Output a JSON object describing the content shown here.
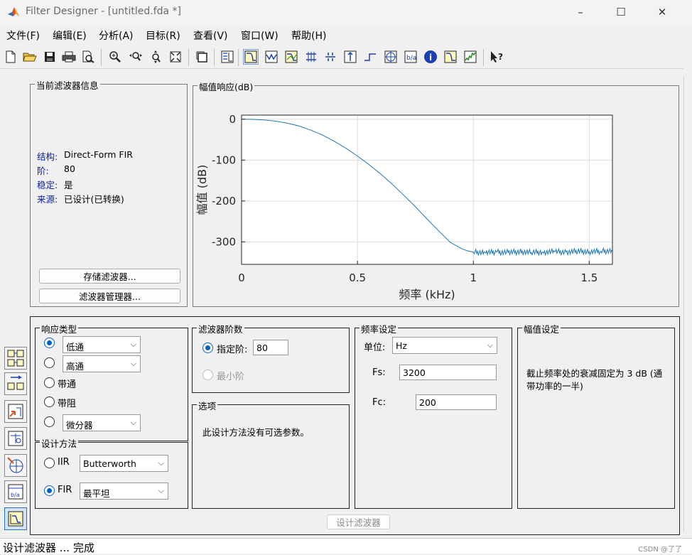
{
  "window": {
    "title": "Filter Designer  -  [untitled.fda *]",
    "minimize": "–",
    "maximize": "☐",
    "close": "✕"
  },
  "menu": [
    "文件(F)",
    "编辑(E)",
    "分析(A)",
    "目标(R)",
    "查看(V)",
    "窗口(W)",
    "帮助(H)"
  ],
  "toolbar_icons": [
    "new-file-icon",
    "open-folder-icon",
    "save-icon",
    "print-icon",
    "print-preview-icon",
    "zoom-in-icon",
    "zoom-x-icon",
    "zoom-y-icon",
    "full-view-icon",
    "new-window-icon",
    "legend-icon",
    "magnitude-response-icon",
    "phase-response-icon",
    "mag-phase-icon",
    "group-delay-icon",
    "phase-delay-icon",
    "impulse-response-icon",
    "step-response-icon",
    "pole-zero-icon",
    "filter-coefficients-icon",
    "filter-info-icon",
    "magnitude-estimate-icon",
    "round-off-noise-icon",
    "whats-this-icon"
  ],
  "filter_info": {
    "title": "当前滤波器信息",
    "rows": [
      {
        "key": "结构:",
        "value": "Direct-Form FIR"
      },
      {
        "key": "阶:",
        "value": "80"
      },
      {
        "key": "稳定:",
        "value": "是"
      },
      {
        "key": "来源:",
        "value": "已设计(已转换)"
      }
    ],
    "store_button": "存储滤波器...",
    "manager_button": "滤波器管理器..."
  },
  "chart_data": {
    "type": "line",
    "panel_title": "幅值响应(dB)",
    "xlabel": "频率 (kHz)",
    "ylabel": "幅值 (dB)",
    "xlim": [
      0,
      1.6
    ],
    "ylim": [
      -355,
      10
    ],
    "xticks": [
      0,
      0.5,
      1,
      1.5
    ],
    "xtick_labels": [
      "0",
      "0.5",
      "1",
      "1.5"
    ],
    "yticks": [
      0,
      -100,
      -200,
      -300
    ],
    "ytick_labels": [
      "0",
      "-100",
      "-200",
      "-300"
    ],
    "grid": true,
    "color": "#1f77b4",
    "series": [
      {
        "x": [
          0,
          0.05,
          0.1,
          0.15,
          0.2,
          0.25,
          0.3,
          0.35,
          0.4,
          0.45,
          0.5,
          0.55,
          0.6,
          0.65,
          0.7,
          0.75,
          0.8,
          0.85,
          0.9,
          0.95,
          0.975,
          1.0,
          1.05,
          1.1,
          1.15,
          1.2,
          1.25,
          1.3,
          1.35,
          1.4,
          1.45,
          1.5,
          1.55,
          1.6
        ],
        "y": [
          0,
          -0.5,
          -2,
          -5,
          -10,
          -17,
          -27,
          -39,
          -54,
          -71,
          -90,
          -111,
          -134,
          -159,
          -186,
          -214,
          -244,
          -273,
          -301,
          -317,
          -322,
          -325,
          -326,
          -325,
          -326,
          -324,
          -326,
          -325,
          -324,
          -325,
          -323,
          -324,
          -323,
          -322
        ]
      }
    ]
  },
  "response_type": {
    "title": "响应类型",
    "lowpass": "低通",
    "highpass": "高通",
    "bandpass": "带通",
    "bandstop": "带阻",
    "differentiator": "微分器"
  },
  "design_method": {
    "title": "设计方法",
    "iir_label": "IIR",
    "iir_value": "Butterworth",
    "fir_label": "FIR",
    "fir_value": "最平坦"
  },
  "filter_order": {
    "title": "滤波器阶数",
    "specify_label": "指定阶:",
    "specify_value": "80",
    "minimum_label": "最小阶"
  },
  "options": {
    "title": "选项",
    "text": "此设计方法没有可选参数。"
  },
  "freq_spec": {
    "title": "频率设定",
    "units_label": "单位:",
    "units_value": "Hz",
    "fs_label": "Fs:",
    "fs_value": "3200",
    "fc_label": "Fc:",
    "fc_value": "200"
  },
  "mag_spec": {
    "title": "幅值设定",
    "text": "截止频率处的衰减固定为 3 dB (通带功率的一半)"
  },
  "design_button": "设计滤波器",
  "left_strip_icons": [
    "transform-filter-icon",
    "convert-structure-icon",
    "import-filter-icon",
    "pole-zero-editor-icon",
    "multirate-icon",
    "realize-model-icon",
    "design-filter-icon"
  ],
  "status": "设计滤波器 ... 完成",
  "watermark": "CSDN @了了"
}
